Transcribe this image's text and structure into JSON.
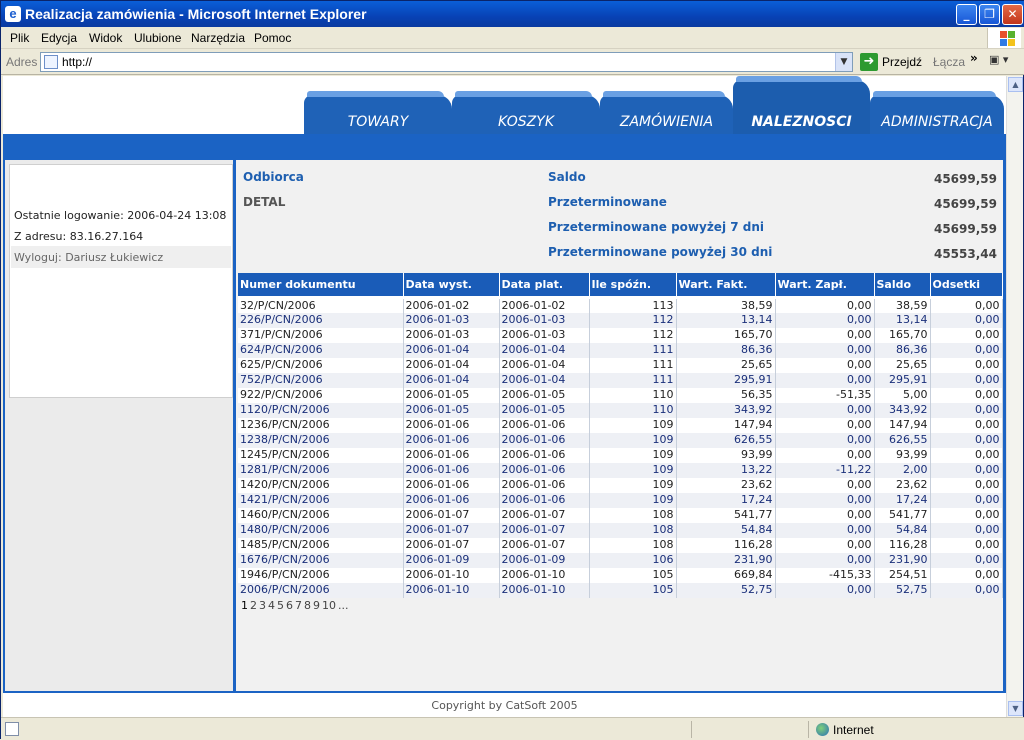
{
  "window": {
    "title": "Realizacja zamówienia - Microsoft Internet Explorer"
  },
  "menu": [
    "Plik",
    "Edycja",
    "Widok",
    "Ulubione",
    "Narzędzia",
    "Pomoc"
  ],
  "address": {
    "label": "Adres",
    "url": "http://",
    "go_label": "Przejdź",
    "links_label": "Łącza",
    "chevron": "»"
  },
  "tabs": [
    "TOWARY",
    "KOSZYK",
    "ZAMÓWIENIA",
    "NALEZNOSCI",
    "ADMINISTRACJA"
  ],
  "active_tab": "NALEZNOSCI",
  "session": {
    "last_login": "Ostatnie logowanie: 2006-04-24 13:08",
    "from_address": "Z adresu: 83.16.27.164",
    "logout": "Wyloguj: Dariusz Łukiewicz"
  },
  "summary": {
    "odbiorca_label": "Odbiorca",
    "odbiorca_value": "DETAL",
    "rows": [
      {
        "label": "Saldo",
        "value": "45699,59"
      },
      {
        "label": "Przeterminowane",
        "value": "45699,59"
      },
      {
        "label": "Przeterminowane powyżej 7 dni",
        "value": "45699,59"
      },
      {
        "label": "Przeterminowane powyżej 30 dni",
        "value": "45553,44"
      }
    ]
  },
  "table": {
    "columns": [
      "Numer dokumentu",
      "Data wyst.",
      "Data plat.",
      "Ile spóźn.",
      "Wart. Fakt.",
      "Wart. Zapł.",
      "Saldo",
      "Odsetki"
    ],
    "rows": [
      [
        "32/P/CN/2006",
        "2006-01-02",
        "2006-01-02",
        "113",
        "38,59",
        "0,00",
        "38,59",
        "0,00"
      ],
      [
        "226/P/CN/2006",
        "2006-01-03",
        "2006-01-03",
        "112",
        "13,14",
        "0,00",
        "13,14",
        "0,00"
      ],
      [
        "371/P/CN/2006",
        "2006-01-03",
        "2006-01-03",
        "112",
        "165,70",
        "0,00",
        "165,70",
        "0,00"
      ],
      [
        "624/P/CN/2006",
        "2006-01-04",
        "2006-01-04",
        "111",
        "86,36",
        "0,00",
        "86,36",
        "0,00"
      ],
      [
        "625/P/CN/2006",
        "2006-01-04",
        "2006-01-04",
        "111",
        "25,65",
        "0,00",
        "25,65",
        "0,00"
      ],
      [
        "752/P/CN/2006",
        "2006-01-04",
        "2006-01-04",
        "111",
        "295,91",
        "0,00",
        "295,91",
        "0,00"
      ],
      [
        "922/P/CN/2006",
        "2006-01-05",
        "2006-01-05",
        "110",
        "56,35",
        "-51,35",
        "5,00",
        "0,00"
      ],
      [
        "1120/P/CN/2006",
        "2006-01-05",
        "2006-01-05",
        "110",
        "343,92",
        "0,00",
        "343,92",
        "0,00"
      ],
      [
        "1236/P/CN/2006",
        "2006-01-06",
        "2006-01-06",
        "109",
        "147,94",
        "0,00",
        "147,94",
        "0,00"
      ],
      [
        "1238/P/CN/2006",
        "2006-01-06",
        "2006-01-06",
        "109",
        "626,55",
        "0,00",
        "626,55",
        "0,00"
      ],
      [
        "1245/P/CN/2006",
        "2006-01-06",
        "2006-01-06",
        "109",
        "93,99",
        "0,00",
        "93,99",
        "0,00"
      ],
      [
        "1281/P/CN/2006",
        "2006-01-06",
        "2006-01-06",
        "109",
        "13,22",
        "-11,22",
        "2,00",
        "0,00"
      ],
      [
        "1420/P/CN/2006",
        "2006-01-06",
        "2006-01-06",
        "109",
        "23,62",
        "0,00",
        "23,62",
        "0,00"
      ],
      [
        "1421/P/CN/2006",
        "2006-01-06",
        "2006-01-06",
        "109",
        "17,24",
        "0,00",
        "17,24",
        "0,00"
      ],
      [
        "1460/P/CN/2006",
        "2006-01-07",
        "2006-01-07",
        "108",
        "541,77",
        "0,00",
        "541,77",
        "0,00"
      ],
      [
        "1480/P/CN/2006",
        "2006-01-07",
        "2006-01-07",
        "108",
        "54,84",
        "0,00",
        "54,84",
        "0,00"
      ],
      [
        "1485/P/CN/2006",
        "2006-01-07",
        "2006-01-07",
        "108",
        "116,28",
        "0,00",
        "116,28",
        "0,00"
      ],
      [
        "1676/P/CN/2006",
        "2006-01-09",
        "2006-01-09",
        "106",
        "231,90",
        "0,00",
        "231,90",
        "0,00"
      ],
      [
        "1946/P/CN/2006",
        "2006-01-10",
        "2006-01-10",
        "105",
        "669,84",
        "-415,33",
        "254,51",
        "0,00"
      ],
      [
        "2006/P/CN/2006",
        "2006-01-10",
        "2006-01-10",
        "105",
        "52,75",
        "0,00",
        "52,75",
        "0,00"
      ]
    ]
  },
  "pager": [
    "1",
    "2",
    "3",
    "4",
    "5",
    "6",
    "7",
    "8",
    "9",
    "10",
    "..."
  ],
  "footer": "Copyright by CatSoft 2005",
  "status": {
    "zone": "Internet"
  },
  "colors": {
    "brand_blue": "#1b63c4",
    "link_text": "#1e5fb0"
  }
}
